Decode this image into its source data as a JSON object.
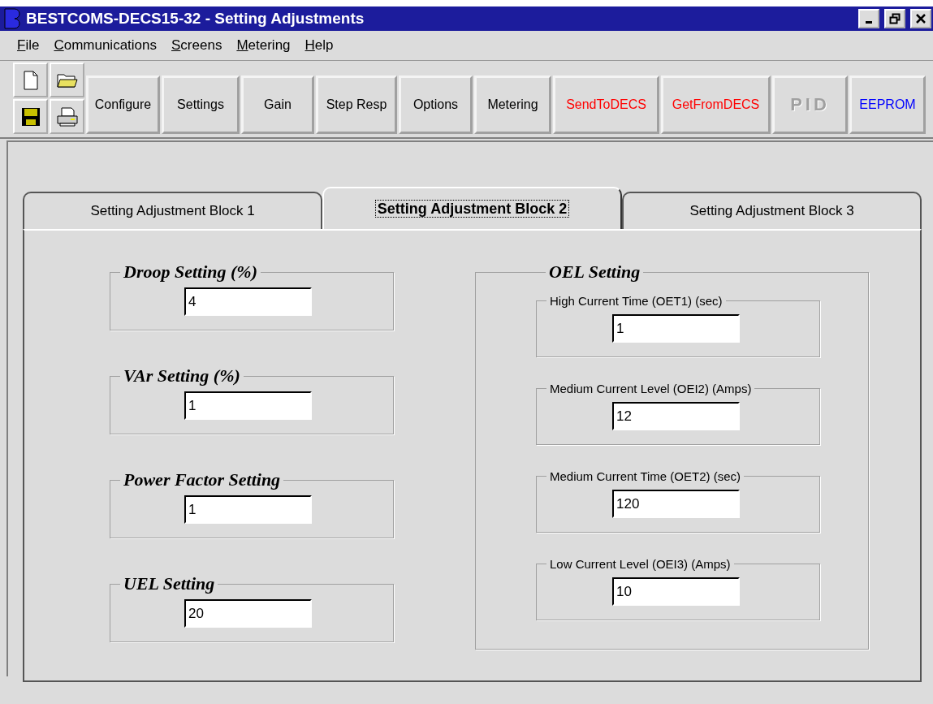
{
  "window": {
    "title": "BESTCOMS-DECS15-32 - Setting Adjustments"
  },
  "menu": [
    "File",
    "Communications",
    "Screens",
    "Metering",
    "Help"
  ],
  "toolbar": {
    "buttons": [
      {
        "label": "Configure",
        "color": "#000000",
        "disabled": false
      },
      {
        "label": "Settings",
        "color": "#000000",
        "disabled": false
      },
      {
        "label": "Gain",
        "color": "#000000",
        "disabled": false
      },
      {
        "label": "Step Resp",
        "color": "#000000",
        "disabled": false
      },
      {
        "label": "Options",
        "color": "#000000",
        "disabled": false
      },
      {
        "label": "Metering",
        "color": "#000000",
        "disabled": false
      },
      {
        "label": "SendToDECS",
        "color": "#ff0000",
        "disabled": false
      },
      {
        "label": "GetFromDECS",
        "color": "#ff0000",
        "disabled": false
      },
      {
        "label": "PID",
        "color": "#a0a0a0",
        "disabled": true
      },
      {
        "label": "EEPROM",
        "color": "#0000ff",
        "disabled": false
      }
    ]
  },
  "tabs": [
    {
      "label": "Setting Adjustment Block 1",
      "selected": false
    },
    {
      "label": "Setting Adjustment Block 2",
      "selected": true
    },
    {
      "label": "Setting Adjustment Block 3",
      "selected": false
    }
  ],
  "left_groups": [
    {
      "title": "Droop Setting (%)",
      "value": "4"
    },
    {
      "title": "VAr Setting (%)",
      "value": "1"
    },
    {
      "title": "Power Factor Setting",
      "value": "1"
    },
    {
      "title": "UEL Setting",
      "value": "20"
    }
  ],
  "oel": {
    "title": "OEL Setting",
    "groups": [
      {
        "title": "High Current Time (OET1) (sec)",
        "value": "1"
      },
      {
        "title": "Medium Current Level (OEI2) (Amps)",
        "value": "12"
      },
      {
        "title": "Medium Current Time (OET2) (sec)",
        "value": "120"
      },
      {
        "title": "Low Current Level (OEI3) (Amps)",
        "value": "10"
      }
    ]
  }
}
